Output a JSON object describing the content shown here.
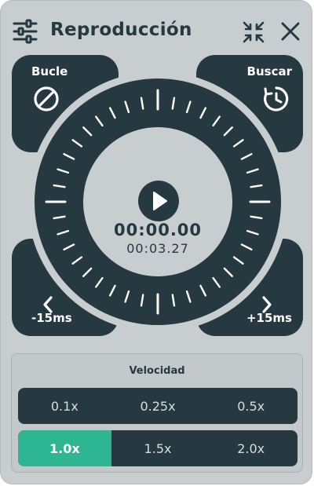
{
  "header": {
    "title": "Reproducción",
    "settings_icon": "sliders-icon",
    "collapse_icon": "collapse-arrows-icon",
    "close_icon": "close-icon"
  },
  "controls": {
    "loop": {
      "label": "Bucle",
      "icon": "loop-off-icon"
    },
    "seek": {
      "label": "Buscar",
      "icon": "seek-clock-icon"
    },
    "back": {
      "label": "-15ms",
      "icon": "chevron-left-icon"
    },
    "forward": {
      "label": "+15ms",
      "icon": "chevron-right-icon"
    }
  },
  "playback": {
    "current_time": "00:00.00",
    "total_time": "00:03.27",
    "play_icon": "play-icon"
  },
  "speed": {
    "title": "Velocidad",
    "options": [
      "0.1x",
      "0.25x",
      "0.5x",
      "1.0x",
      "1.5x",
      "2.0x"
    ],
    "selected": "1.0x"
  },
  "colors": {
    "panel": "#c8cdcf",
    "dark": "#263840",
    "accent": "#2eb592",
    "tick": "#ffffff"
  }
}
